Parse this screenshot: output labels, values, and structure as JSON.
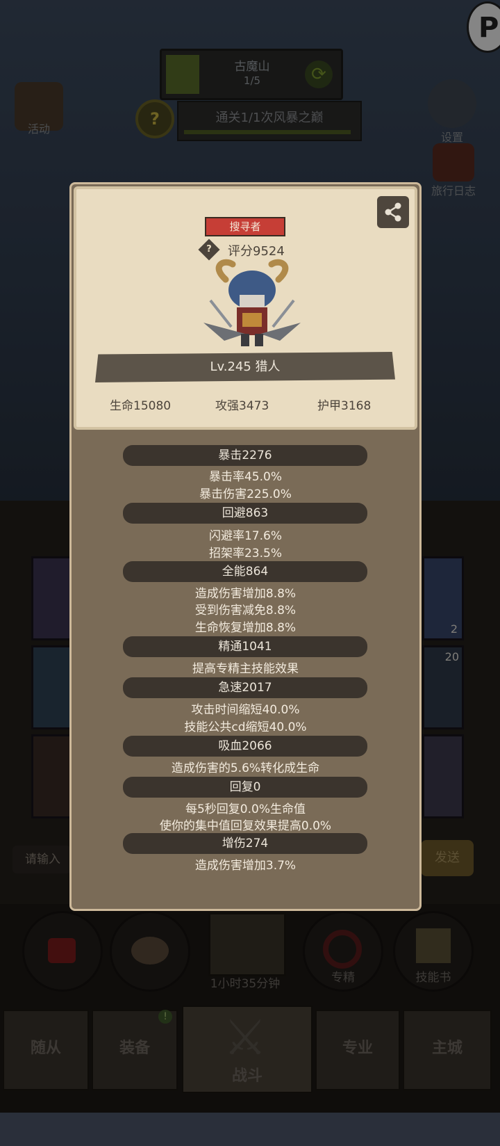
{
  "stage": {
    "name": "古魔山",
    "progress": "1/5"
  },
  "quest": {
    "text": "通关1/1次风暴之巅"
  },
  "left_side": {
    "activity_label": "活动"
  },
  "right_side": {
    "settings_label": "设置",
    "journal_label": "旅行日志"
  },
  "chat": {
    "placeholder": "请输入",
    "send_label": "发送"
  },
  "bottom_actions": [
    {
      "label": ""
    },
    {
      "label": ""
    },
    {
      "label": "1小时35分钟"
    },
    {
      "label": "专精"
    },
    {
      "label": "技能书"
    }
  ],
  "bottom_tabs": [
    {
      "label": "随从"
    },
    {
      "label": "装备"
    },
    {
      "label": "战斗"
    },
    {
      "label": "专业"
    },
    {
      "label": "主城"
    }
  ],
  "badges": {
    "slot_count_1": "2",
    "slot_count_2": "20"
  },
  "profile": {
    "role_badge": "搜寻者",
    "score": "评分9524",
    "level_title": "Lv.245 猎人",
    "hp": "生命15080",
    "attack": "攻强3473",
    "armor": "护甲3168"
  },
  "stats": [
    {
      "header": "暴击2276",
      "lines": [
        "暴击率45.0%",
        "暴击伤害225.0%"
      ]
    },
    {
      "header": "回避863",
      "lines": [
        "闪避率17.6%",
        "招架率23.5%"
      ]
    },
    {
      "header": "全能864",
      "lines": [
        "造成伤害增加8.8%",
        "受到伤害减免8.8%",
        "生命恢复增加8.8%"
      ]
    },
    {
      "header": "精通1041",
      "lines": [
        "提高专精主技能效果"
      ]
    },
    {
      "header": "急速2017",
      "lines": [
        "攻击时间缩短40.0%",
        "技能公共cd缩短40.0%"
      ]
    },
    {
      "header": "吸血2066",
      "lines": [
        "造成伤害的5.6%转化成生命"
      ]
    },
    {
      "header": "回复0",
      "lines": [
        "每5秒回复0.0%生命值",
        "使你的集中值回复效果提高0.0%"
      ]
    },
    {
      "header": "增伤274",
      "lines": [
        "造成伤害增加3.7%"
      ]
    }
  ]
}
